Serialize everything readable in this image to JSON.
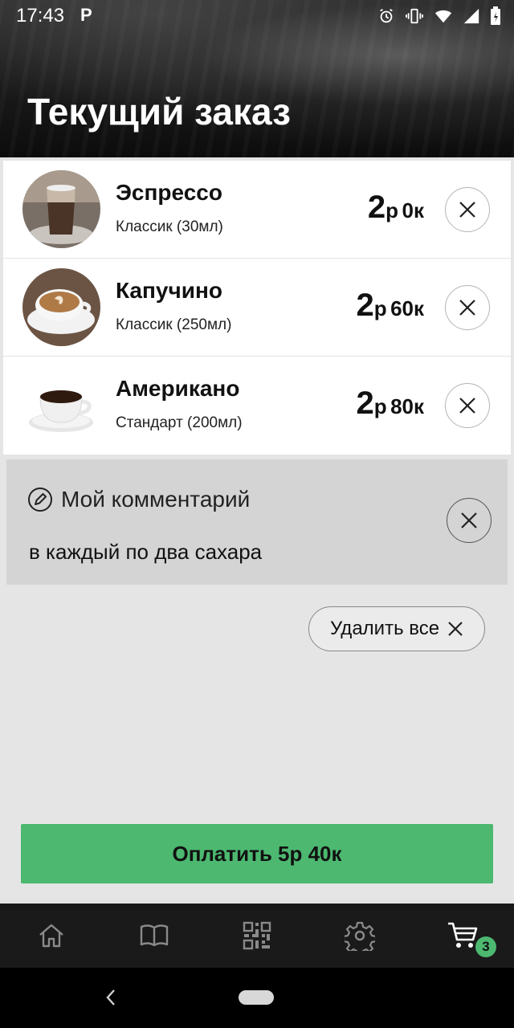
{
  "status_bar": {
    "time": "17:43",
    "app_indicator": "P",
    "icons": [
      "alarm-icon",
      "vibrate-icon",
      "wifi-icon",
      "signal-icon",
      "battery-icon"
    ]
  },
  "page": {
    "title": "Текущий заказ"
  },
  "order": {
    "items": [
      {
        "name": "Эспрессо",
        "desc": "Классик (30мл)",
        "price_rub": "2",
        "price_rub_unit": "р",
        "price_kop": "0к",
        "image": "latte-glass"
      },
      {
        "name": "Капучино",
        "desc": "Классик (250мл)",
        "price_rub": "2",
        "price_rub_unit": "р",
        "price_kop": "60к",
        "image": "cappuccino-cup"
      },
      {
        "name": "Американо",
        "desc": "Стандарт (200мл)",
        "price_rub": "2",
        "price_rub_unit": "р",
        "price_kop": "80к",
        "image": "black-coffee-cup"
      }
    ]
  },
  "comment": {
    "title": "Мой комментарий",
    "text": "в каждый по два сахара"
  },
  "actions": {
    "delete_all_label": "Удалить все",
    "pay_label": "Оплатить 5р 40к"
  },
  "bottom_nav": {
    "items": [
      "home-icon",
      "book-icon",
      "qr-code-icon",
      "gear-icon",
      "cart-icon"
    ],
    "cart_count": "3"
  },
  "colors": {
    "accent": "#4cb870",
    "header_bg": "#1a1a1a",
    "page_bg": "#e5e5e5",
    "comment_bg": "#d4d4d4"
  }
}
